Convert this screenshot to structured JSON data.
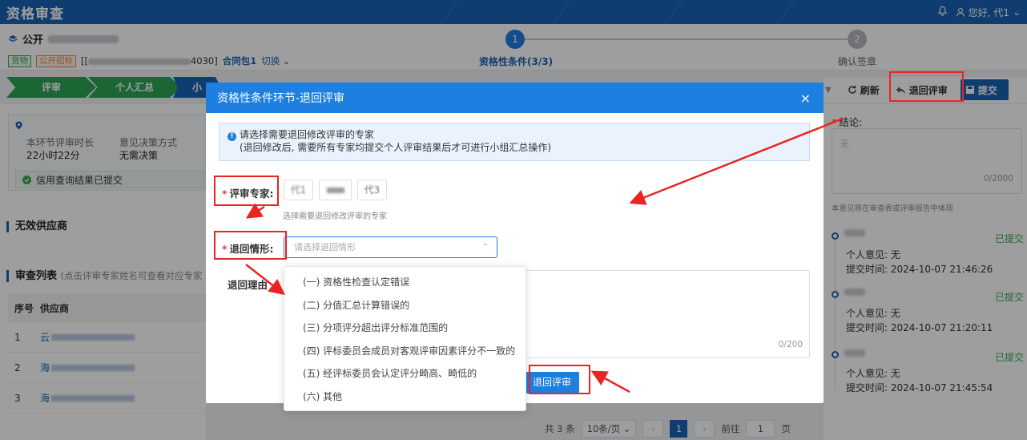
{
  "header": {
    "app_title": "资格审查",
    "greeting": "您好, 代1"
  },
  "project": {
    "name_visible": "公开",
    "tags": [
      "货物",
      "公开招标"
    ],
    "code_suffix": "[[",
    "code_end": "4030]",
    "contract": "合同包1",
    "switch_label": "切换"
  },
  "stepper": [
    {
      "num": "1",
      "label": "资格性条件(3/3)"
    },
    {
      "num": "2",
      "label": "确认签章"
    }
  ],
  "nav": [
    "评审",
    "个人汇总",
    "小"
  ],
  "left": {
    "duration_label": "本环节评审时长",
    "duration_value": "22小时22分",
    "decision_label": "意见决策方式",
    "decision_value": "无需决策",
    "credit_status": "信用查询结果已提交",
    "invalid_title": "无效供应商",
    "list_title": "审查列表",
    "list_hint": "(点击评审专家姓名可查看对应专家",
    "col_no": "序号",
    "col_supplier": "供应商",
    "rows": [
      {
        "no": "1",
        "supplier": "云"
      },
      {
        "no": "2",
        "supplier": "海"
      },
      {
        "no": "3",
        "supplier": "海"
      }
    ]
  },
  "toolbar": {
    "refresh": "刷新",
    "return": "退回评审",
    "submit": "提交"
  },
  "right": {
    "conclusion_label": "结论:",
    "conclusion_placeholder": "无",
    "conclusion_count": "0/2000",
    "report_note": "本意见将在审查表或评审报告中体现",
    "opinions": [
      {
        "status": "已提交",
        "opinion": "个人意见:  无",
        "time": "提交时间:  2024-10-07 21:46:26"
      },
      {
        "status": "已提交",
        "opinion": "个人意见:  无",
        "time": "提交时间:  2024-10-07 21:20:11"
      },
      {
        "status": "已提交",
        "opinion": "个人意见:  无",
        "time": "提交时间:  2024-10-07 21:45:54"
      }
    ]
  },
  "pager": {
    "total": "共 3 条",
    "page_size": "10条/页",
    "current": "1",
    "goto_label": "前往",
    "goto_value": "1",
    "page_unit": "页"
  },
  "modal": {
    "title": "资格性条件环节-退回评审",
    "notice_line1": "请选择需要退回修改评审的专家",
    "notice_line2": "(退回修改后, 需要所有专家均提交个人评审结果后才可进行小组汇总操作)",
    "expert_label": "评审专家:",
    "experts": [
      "代1",
      "",
      "代3"
    ],
    "expert_hint": "选择需要退回修改评审的专家",
    "situation_label": "退回情形:",
    "situation_placeholder": "请选择退回情形",
    "reason_label": "退回理由",
    "reason_count": "0/200",
    "submit": "退回评审"
  },
  "dropdown_options": [
    "(一) 资格性检查认定错误",
    "(二) 分值汇总计算错误的",
    "(三) 分项评分超出评分标准范围的",
    "(四) 评标委员会成员对客观评审因素评分不一致的",
    "(五) 经评标委员会认定评分畸高、畸低的",
    "(六) 其他"
  ],
  "colors": {
    "primary": "#1a63b4",
    "modal_header": "#1d7fe0",
    "success": "#3aa65a",
    "annotation": "#e82424"
  }
}
